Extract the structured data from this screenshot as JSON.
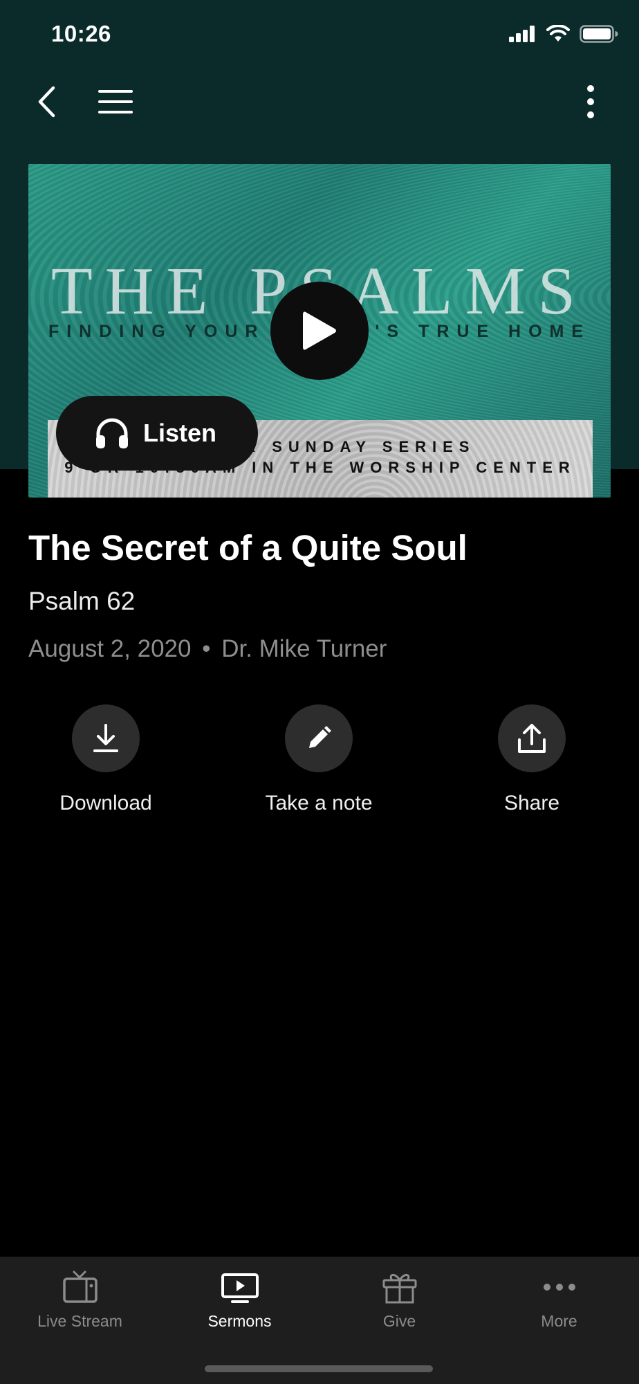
{
  "status_bar": {
    "time": "10:26"
  },
  "hero": {
    "title": "THE PSALMS",
    "subtitle": "FINDING YOUR HEART'S TRUE HOME",
    "band_line1": "4-WEEK SUNDAY SERIES",
    "band_line2": "9 OR 10:30AM IN THE WORSHIP CENTER",
    "listen_label": "Listen"
  },
  "sermon": {
    "title": "The Secret of a Quite Soul",
    "scripture": "Psalm 62",
    "date": "August 2, 2020",
    "separator": "•",
    "speaker": "Dr. Mike Turner"
  },
  "actions": [
    {
      "label": "Download",
      "icon": "download-icon"
    },
    {
      "label": "Take a note",
      "icon": "pencil-icon"
    },
    {
      "label": "Share",
      "icon": "share-icon"
    }
  ],
  "tabs": [
    {
      "label": "Live Stream",
      "icon": "tv-icon",
      "active": false
    },
    {
      "label": "Sermons",
      "icon": "play-screen-icon",
      "active": true
    },
    {
      "label": "Give",
      "icon": "gift-icon",
      "active": false
    },
    {
      "label": "More",
      "icon": "more-dots-icon",
      "active": false
    }
  ],
  "colors": {
    "header_bg": "#0b2b2b",
    "page_bg": "#000000",
    "tabbar_bg": "#1e1e1e",
    "muted_text": "#8e8e8e"
  }
}
